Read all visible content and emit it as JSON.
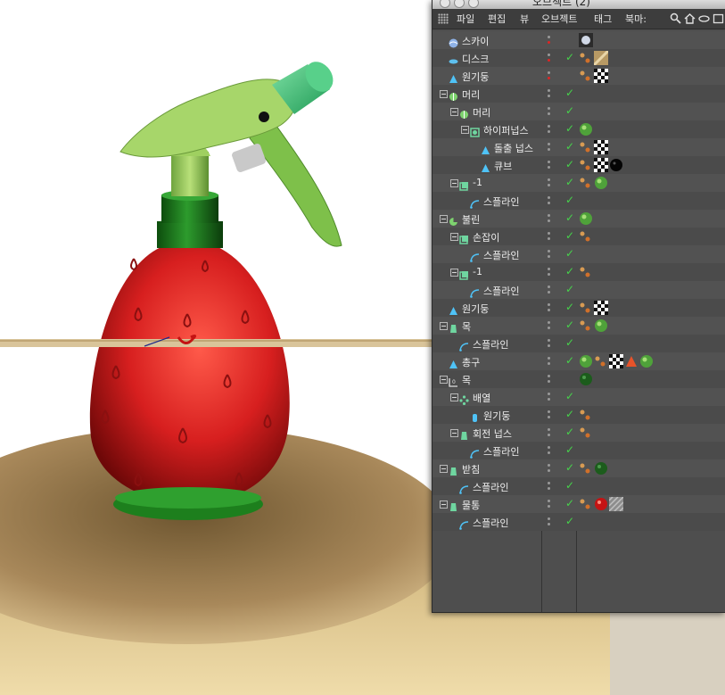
{
  "window": {
    "title": "오브젝트 (2)"
  },
  "menu": [
    {
      "label": "파일",
      "x": 0
    },
    {
      "label": "편집",
      "x": 0
    },
    {
      "label": "뷰",
      "x": 0
    },
    {
      "label": "오브젝트",
      "x": 0
    },
    {
      "label": "태그",
      "x": 0
    },
    {
      "label": "북마:",
      "x": 0
    }
  ],
  "menu_icons": [
    "search-icon",
    "home-icon",
    "eye-icon",
    "new-window-icon"
  ],
  "tree": [
    {
      "label": "스카이",
      "level": 0,
      "icon": "sky-icon",
      "expanded": false,
      "dot": "red",
      "check": false,
      "tags": [
        "sky-tag"
      ]
    },
    {
      "label": "디스크",
      "level": 0,
      "icon": "disc-icon",
      "expanded": false,
      "dot": "red",
      "check": true,
      "tags": [
        "texture-tag",
        "floor-material"
      ]
    },
    {
      "label": "원기둥",
      "level": 0,
      "icon": "cylinder-icon",
      "expanded": false,
      "dot": "red",
      "check": false,
      "tags": [
        "texture-tag",
        "checker-material"
      ]
    },
    {
      "label": "머리",
      "level": 0,
      "icon": "group-icon",
      "expanded": true,
      "dot": "grey",
      "check": true,
      "tags": []
    },
    {
      "label": "머리",
      "level": 1,
      "icon": "group-icon",
      "expanded": true,
      "dot": "grey",
      "check": true,
      "tags": []
    },
    {
      "label": "하이퍼넙스",
      "level": 2,
      "icon": "hypernurbs-icon",
      "expanded": true,
      "dot": "grey",
      "check": true,
      "tags": [
        "green-material"
      ]
    },
    {
      "label": "돌출 넙스",
      "level": 3,
      "icon": "extrude-nurbs-icon",
      "expanded": false,
      "dot": "grey",
      "check": true,
      "tags": [
        "texture-tag",
        "checker-material"
      ]
    },
    {
      "label": "큐브",
      "level": 3,
      "icon": "cube-icon",
      "expanded": false,
      "dot": "grey",
      "check": true,
      "tags": [
        "texture-tag",
        "checker-material",
        "black-material"
      ]
    },
    {
      "label": "-1",
      "level": 1,
      "icon": "object-icon",
      "expanded": true,
      "dot": "grey",
      "check": true,
      "tags": [
        "texture-tag",
        "green-material"
      ]
    },
    {
      "label": "스플라인",
      "level": 2,
      "icon": "spline-icon",
      "expanded": false,
      "dot": "grey",
      "check": true,
      "tags": []
    },
    {
      "label": "불린",
      "level": 0,
      "icon": "boole-icon",
      "expanded": true,
      "dot": "grey",
      "check": true,
      "tags": [
        "green-material"
      ]
    },
    {
      "label": "손잡이",
      "level": 1,
      "icon": "object-icon",
      "expanded": true,
      "dot": "grey",
      "check": true,
      "tags": [
        "texture-tag"
      ]
    },
    {
      "label": "스플라인",
      "level": 2,
      "icon": "spline-icon",
      "expanded": false,
      "dot": "grey",
      "check": true,
      "tags": []
    },
    {
      "label": "-1",
      "level": 1,
      "icon": "object-icon",
      "expanded": true,
      "dot": "grey",
      "check": true,
      "tags": [
        "texture-tag"
      ]
    },
    {
      "label": "스플라인",
      "level": 2,
      "icon": "spline-icon",
      "expanded": false,
      "dot": "grey",
      "check": true,
      "tags": []
    },
    {
      "label": "원기둥",
      "level": 0,
      "icon": "cylinder-icon",
      "expanded": false,
      "dot": "grey",
      "check": true,
      "tags": [
        "texture-tag",
        "checker-material"
      ]
    },
    {
      "label": "목",
      "level": 0,
      "icon": "lathe-icon",
      "expanded": true,
      "dot": "grey",
      "check": true,
      "tags": [
        "texture-tag",
        "green-material"
      ]
    },
    {
      "label": "스플라인",
      "level": 1,
      "icon": "spline-icon",
      "expanded": false,
      "dot": "grey",
      "check": true,
      "tags": []
    },
    {
      "label": "총구",
      "level": 0,
      "icon": "cone-icon",
      "expanded": false,
      "dot": "grey",
      "check": true,
      "tags": [
        "green-material",
        "texture-tag",
        "checker-material",
        "warning-icon",
        "green-material"
      ]
    },
    {
      "label": "목",
      "level": 0,
      "icon": "null-icon",
      "expanded": true,
      "dot": "grey",
      "check": false,
      "tags": [
        "dark-green-material"
      ]
    },
    {
      "label": "배열",
      "level": 1,
      "icon": "array-icon",
      "expanded": true,
      "dot": "grey",
      "check": true,
      "tags": []
    },
    {
      "label": "원기둥",
      "level": 2,
      "icon": "cylinder-small-icon",
      "expanded": false,
      "dot": "grey",
      "check": true,
      "tags": [
        "texture-tag"
      ]
    },
    {
      "label": "회전 넙스",
      "level": 1,
      "icon": "lathe-icon",
      "expanded": true,
      "dot": "grey",
      "check": true,
      "tags": [
        "texture-tag"
      ]
    },
    {
      "label": "스플라인",
      "level": 2,
      "icon": "spline-icon",
      "expanded": false,
      "dot": "grey",
      "check": true,
      "tags": []
    },
    {
      "label": "받침",
      "level": 0,
      "icon": "lathe-icon",
      "expanded": true,
      "dot": "grey",
      "check": true,
      "tags": [
        "texture-tag",
        "dark-green-material"
      ]
    },
    {
      "label": "스플라인",
      "level": 1,
      "icon": "spline-icon",
      "expanded": false,
      "dot": "grey",
      "check": true,
      "tags": []
    },
    {
      "label": "물통",
      "level": 0,
      "icon": "lathe-icon",
      "expanded": true,
      "dot": "grey",
      "check": true,
      "tags": [
        "texture-tag",
        "red-material",
        "hatched-material"
      ]
    },
    {
      "label": "스플라인",
      "level": 1,
      "icon": "spline-icon",
      "expanded": false,
      "dot": "grey",
      "check": true,
      "tags": []
    }
  ]
}
